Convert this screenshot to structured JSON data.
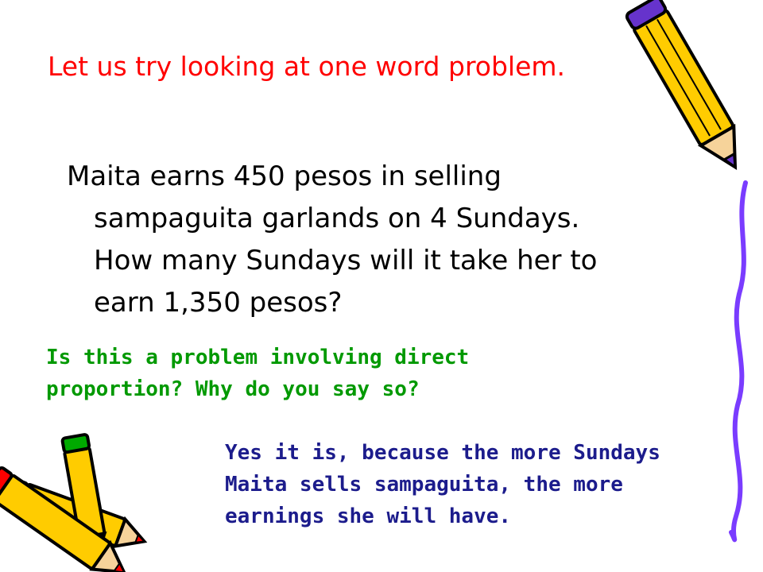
{
  "slide": {
    "title": "Let us try looking at one word problem.",
    "problem_lines": [
      "Maita earns 450 pesos in selling",
      "sampaguita garlands on 4 Sundays.",
      "How many Sundays will it take her to",
      "earn 1,350 pesos?"
    ],
    "question_lines": [
      "Is this a problem involving direct",
      "proportion? Why do you say so?"
    ],
    "answer_lines": [
      "Yes it is, because the more Sundays",
      "Maita sells sampaguita, the more",
      "earnings she will have."
    ]
  },
  "colors": {
    "title": "#ff0000",
    "problem": "#000000",
    "question": "#009900",
    "answer": "#1c1c8c",
    "pencil_body": "#ffcc00",
    "pencil_outline": "#000000",
    "pencil_eraser": "#6633cc",
    "pencil_tip_red": "#ff0000",
    "pencil_ferrule_green": "#00aa00",
    "squiggle": "#7a3cff"
  },
  "decorations": {
    "top_right": "pencil-icon",
    "bottom_left": "pencils-icon",
    "right_edge": "squiggle-line"
  }
}
